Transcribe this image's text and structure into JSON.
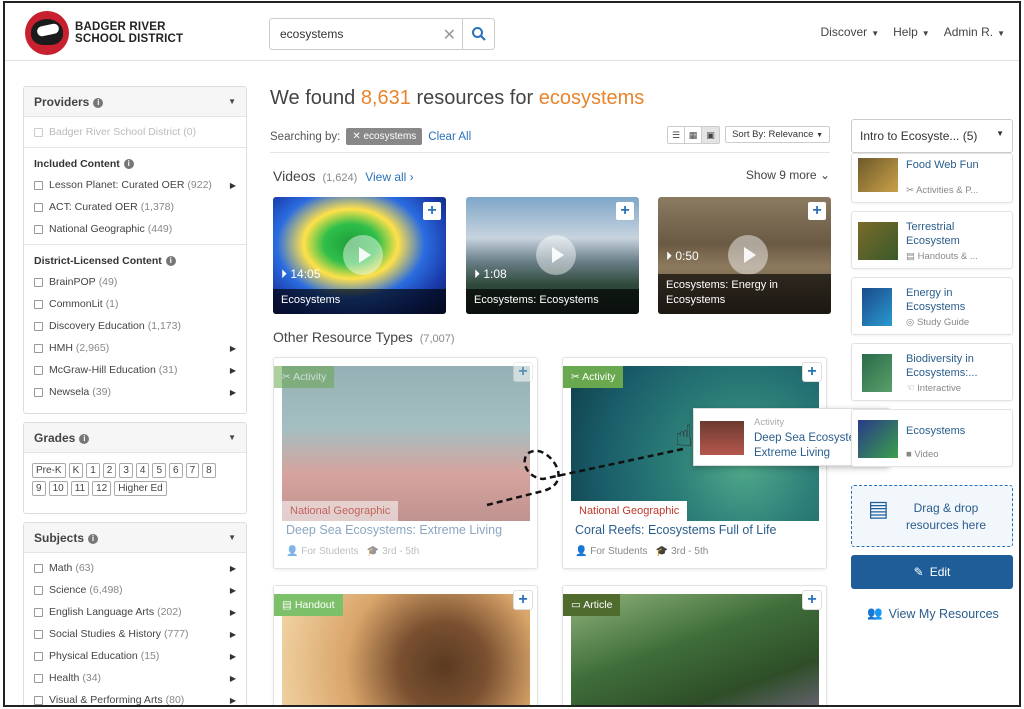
{
  "header": {
    "logo_text_line1": "BADGER RIVER",
    "logo_text_line2": "SCHOOL DISTRICT",
    "search_value": "ecosystems",
    "nav": [
      "Discover",
      "Help",
      "Admin R."
    ]
  },
  "sidebar": {
    "providers_title": "Providers",
    "district_item": "Badger River School District",
    "district_count": "(0)",
    "included_title": "Included Content",
    "included": [
      {
        "label": "Lesson Planet: Curated OER",
        "count": "(922)",
        "arrow": true
      },
      {
        "label": "ACT: Curated OER",
        "count": "(1,378)",
        "arrow": false
      },
      {
        "label": "National Geographic",
        "count": "(449)",
        "arrow": false
      }
    ],
    "licensed_title": "District-Licensed Content",
    "licensed": [
      {
        "label": "BrainPOP",
        "count": "(49)",
        "arrow": false
      },
      {
        "label": "CommonLit",
        "count": "(1)",
        "arrow": false
      },
      {
        "label": "Discovery Education",
        "count": "(1,173)",
        "arrow": false
      },
      {
        "label": "HMH",
        "count": "(2,965)",
        "arrow": true
      },
      {
        "label": "McGraw-Hill Education",
        "count": "(31)",
        "arrow": true
      },
      {
        "label": "Newsela",
        "count": "(39)",
        "arrow": true
      }
    ],
    "grades_title": "Grades",
    "grades": [
      "Pre-K",
      "K",
      "1",
      "2",
      "3",
      "4",
      "5",
      "6",
      "7",
      "8",
      "9",
      "10",
      "11",
      "12",
      "Higher Ed"
    ],
    "subjects_title": "Subjects",
    "subjects": [
      {
        "label": "Math",
        "count": "(63)"
      },
      {
        "label": "Science",
        "count": "(6,498)"
      },
      {
        "label": "English Language Arts",
        "count": "(202)"
      },
      {
        "label": "Social Studies & History",
        "count": "(777)"
      },
      {
        "label": "Physical Education",
        "count": "(15)"
      },
      {
        "label": "Health",
        "count": "(34)"
      },
      {
        "label": "Visual & Performing Arts",
        "count": "(80)"
      }
    ]
  },
  "results": {
    "found_prefix": "We found",
    "found_count": "8,631",
    "found_mid": "resources for",
    "found_term": "ecosystems",
    "searching_by": "Searching by:",
    "chip": "ecosystems",
    "clear_all": "Clear All",
    "sort_label": "Sort By: Relevance"
  },
  "videos": {
    "title": "Videos",
    "count": "(1,624)",
    "view_all": "View all",
    "show_more": "Show 9 more",
    "items": [
      {
        "duration": "14:05",
        "title": "Ecosystems"
      },
      {
        "duration": "1:08",
        "title": "Ecosystems: Ecosystems"
      },
      {
        "duration": "0:50",
        "title": "Ecosystems: Energy in Ecosystems"
      }
    ]
  },
  "other": {
    "title": "Other Resource Types",
    "count": "(7,007)",
    "cards": [
      {
        "tag": "Activity",
        "provider": "National Geographic",
        "title": "Deep Sea Ecosystems: Extreme Living",
        "audience": "For Students",
        "grade": "3rd - 5th"
      },
      {
        "tag": "Activity",
        "provider": "National Geographic",
        "title": "Coral Reefs: Ecosystems Full of Life",
        "audience": "For Students",
        "grade": "3rd - 5th"
      },
      {
        "tag": "Handout"
      },
      {
        "tag": "Article"
      }
    ]
  },
  "right": {
    "collection": "Intro to Ecosyste...",
    "collection_count": "(5)",
    "items": [
      {
        "title": "Food Web Fun",
        "sub": "Activities & P..."
      },
      {
        "title": "Terrestrial Ecosystem",
        "sub": "Handouts & ..."
      },
      {
        "title": "Energy in Ecosystems",
        "sub": "Study Guide"
      },
      {
        "title": "Biodiversity in Ecosystems:...",
        "sub": "Interactive"
      },
      {
        "title": "Ecosystems",
        "sub": "Video"
      }
    ],
    "drop_line1": "Drag & drop",
    "drop_line2": "resources here",
    "edit": "Edit",
    "view_my": "View My Resources"
  },
  "drag_ghost": {
    "type": "Activity",
    "title": "Deep Sea Ecosystems: Extreme Living"
  },
  "colors": {
    "accent": "#e8842b",
    "link": "#2a73b8",
    "primary": "#1f5d99",
    "activity_tag": "#6aa84f",
    "article_tag": "#4f6b2e"
  }
}
